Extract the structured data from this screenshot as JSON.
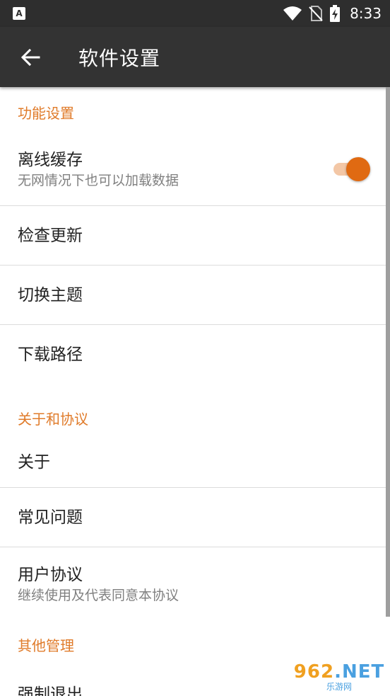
{
  "status_bar": {
    "time": "8:33",
    "icons": [
      "app-notification-icon",
      "wifi-icon",
      "no-sim-icon",
      "battery-charging-icon"
    ]
  },
  "app_bar": {
    "title": "软件设置",
    "back_icon": "arrow-left-icon"
  },
  "sections": {
    "features": {
      "header": "功能设置",
      "offline_cache": {
        "title": "离线缓存",
        "summary": "无网情况下也可以加载数据",
        "enabled": true
      },
      "check_update": {
        "title": "检查更新"
      },
      "switch_theme": {
        "title": "切换主题"
      },
      "download_path": {
        "title": "下载路径"
      }
    },
    "about": {
      "header": "关于和协议",
      "about": {
        "title": "关于"
      },
      "faq": {
        "title": "常见问题"
      },
      "user_agreement": {
        "title": "用户协议",
        "summary": "继续使用及代表同意本协议"
      }
    },
    "other": {
      "header": "其他管理",
      "force_exit": {
        "title": "强制退出"
      }
    }
  },
  "colors": {
    "accent": "#e07b2a",
    "toolbar": "#333333",
    "status_bar": "#2e2e2e",
    "switch_thumb": "#e06a12",
    "switch_track": "#f3c7a6"
  },
  "watermark": {
    "main": "962",
    "suffix": ".NET",
    "sub": "乐游网"
  }
}
